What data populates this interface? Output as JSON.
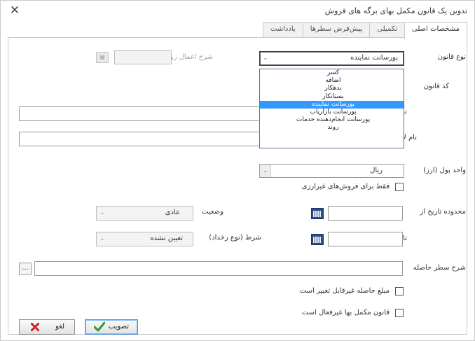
{
  "window": {
    "title": "تدوین یک قانون مکمل بهای برگه های فروش",
    "close_glyph": "✕"
  },
  "tabs": [
    {
      "label": "مشخصات اصلی",
      "active": true
    },
    {
      "label": "تکمیلی",
      "active": false
    },
    {
      "label": "پیش‌فرض سطرها",
      "active": false
    },
    {
      "label": "یادداشت",
      "active": false
    }
  ],
  "form": {
    "rule_type_label": "نوع قانون",
    "rule_type_value": "پورسانت نماینده",
    "rule_code_label": "کد قانون",
    "name_label": "نام",
    "latin_name_label": "نام لاتین",
    "currency_label": "واحد پول (ارز)",
    "currency_value": "ریال",
    "non_currency_only_label": "فقط برای فروش‌های غیرارزی",
    "date_range_from_label": "محدوده تاریخ از",
    "date_range_to_label": "تا",
    "status_label": "وضعیت",
    "status_value": "عادی",
    "condition_label": "شرط (نوع رخداد)",
    "condition_value": "تعیین نشده",
    "result_row_desc_label": "شرح سطر حاصله",
    "ellipsis_label": "...",
    "result_amount_changeable_label": "مبلغ حاصله غیرقابل تغییر است",
    "rule_inactive_label": "قانون مکمل بها غیرفعال است",
    "apply_rule_label": "شرح اعمال روند"
  },
  "rule_type_options": [
    {
      "label": "کسر",
      "selected": false
    },
    {
      "label": "اضافه",
      "selected": false
    },
    {
      "label": "بدهکار",
      "selected": false
    },
    {
      "label": "بستانکار",
      "selected": false
    },
    {
      "label": "پورسانت نماینده",
      "selected": true
    },
    {
      "label": "پورسانت بازاریاب",
      "selected": false
    },
    {
      "label": "پورسانت انجام‌دهنده خدمات",
      "selected": false
    },
    {
      "label": "روند",
      "selected": false
    }
  ],
  "buttons": {
    "approve_label": "تصویب",
    "cancel_label": "لغو"
  },
  "colors": {
    "selection": "#3399ff",
    "approve_icon": "#2e9a2e",
    "cancel_icon": "#c62828",
    "calendar_icon": "#2c4e85"
  }
}
